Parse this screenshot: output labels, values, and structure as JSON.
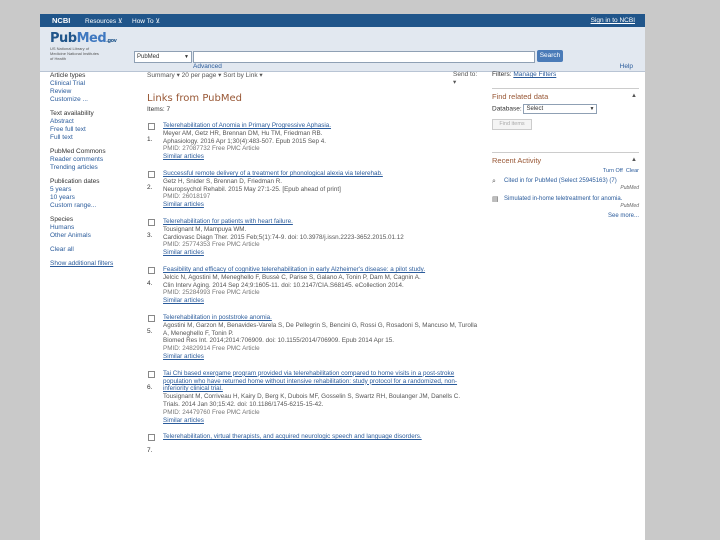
{
  "topbar": {
    "ncbi": "NCBI",
    "resources": "Resources ⊻",
    "howto": "How To ⊻",
    "signin": "Sign in to NCBI"
  },
  "logo": {
    "pub": "Pub",
    "med": "Med",
    "gov": ".gov",
    "nlm": "US National Library of Medicine National Institutes of Health"
  },
  "search": {
    "db": "PubMed",
    "button": "Search",
    "advanced": "Advanced",
    "help": "Help"
  },
  "sidebar": {
    "groups": [
      [
        "Article types",
        "Clinical Trial",
        "Review",
        "Customize ..."
      ],
      [
        "Text availability",
        "Abstract",
        "Free full text",
        "Full text"
      ],
      [
        "PubMed Commons",
        "Reader comments",
        "Trending articles"
      ],
      [
        "Publication dates",
        "5 years",
        "10 years",
        "Custom range..."
      ],
      [
        "Species",
        "Humans",
        "Other Animals"
      ]
    ],
    "clear": "Clear all",
    "show_more": "Show additional filters"
  },
  "toolbar": {
    "summary": "Summary ▾   20 per page ▾   Sort by Link ▾",
    "send": "Send to: ▾"
  },
  "heading": "Links from PubMed",
  "items_label": "Items: 7",
  "results": [
    {
      "num": "1.",
      "title": "Telerehabilitation of Anomia in Primary Progressive Aphasia.",
      "authors": "Meyer AM, Getz HR, Brennan DM, Hu TM, Friedman RB.",
      "journal": "Aphasiology. 2016 Apr 1;30(4):483-507. Epub 2015 Sep 4.",
      "pmid": "PMID: 27087732     Free PMC Article",
      "similar": "Similar articles"
    },
    {
      "num": "2.",
      "title": "Successful remote delivery of a treatment for phonological alexia via telerehab.",
      "authors": "Getz H, Snider S, Brennan D, Friedman R.",
      "journal": "Neuropsychol Rehabil. 2015 May 27:1-25. [Epub ahead of print]",
      "pmid": "PMID: 26018197",
      "similar": "Similar articles"
    },
    {
      "num": "3.",
      "title": "Telerehabilitation for patients with heart failure.",
      "authors": "Tousignant M, Mampuya WM.",
      "journal": "Cardiovasc Diagn Ther. 2015 Feb;5(1):74-9. doi: 10.3978/j.issn.2223-3652.2015.01.12",
      "pmid": "PMID: 25774353     Free PMC Article",
      "similar": "Similar articles"
    },
    {
      "num": "4.",
      "title": "Feasibility and efficacy of cognitive telerehabilitation in early Alzheimer's disease: a pilot study.",
      "authors": "Jelcic N, Agostini M, Meneghello F, Bussè C, Parise S, Galano A, Tonin P, Dam M, Cagnin A.",
      "journal": "Clin Interv Aging. 2014 Sep 24;9:1605-11. doi: 10.2147/CIA.S68145. eCollection 2014.",
      "pmid": "PMID: 25284993     Free PMC Article",
      "similar": "Similar articles"
    },
    {
      "num": "5.",
      "title": "Telerehabilitation in poststroke anomia.",
      "authors": "Agostini M, Garzon M, Benavides-Varela S, De Pellegrin S, Bencini G, Rossi G, Rosadoni S, Mancuso M, Turolla A, Meneghello F, Tonin P.",
      "journal": "Biomed Res Int. 2014;2014:706909. doi: 10.1155/2014/706909. Epub 2014 Apr 15.",
      "pmid": "PMID: 24829914     Free PMC Article",
      "similar": "Similar articles"
    },
    {
      "num": "6.",
      "title": "Tai Chi based exergame program provided via telerehabilitation compared to home visits in a post-stroke population who have returned home without intensive rehabilitation: study protocol for a randomized, non-inferiority clinical trial.",
      "authors": "Tousignant M, Corriveau H, Kairy D, Berg K, Dubois MF, Gosselin S, Swartz RH, Boulanger JM, Danells C.",
      "journal": "Trials. 2014 Jan 30;15:42. doi: 10.1186/1745-6215-15-42.",
      "pmid": "PMID: 24479760     Free PMC Article",
      "similar": "Similar articles"
    },
    {
      "num": "7.",
      "title": "Telerehabilitation, virtual therapists, and acquired neurologic speech and language disorders.",
      "authors": "",
      "journal": "",
      "pmid": "",
      "similar": ""
    }
  ],
  "right": {
    "filters": "Filters:",
    "manage": "Manage Filters",
    "find_related": "Find related data",
    "database_label": "Database:",
    "database_value": "Select",
    "find_button": "Find items",
    "recent_activity": "Recent Activity",
    "turn_off": "Turn Off",
    "clear": "Clear",
    "activities": [
      {
        "icon": "search-icon",
        "text": "Cited in for PubMed (Select 25945163) (7)",
        "source": "PubMed"
      },
      {
        "icon": "document-icon",
        "text": "Simulated in-home teletreatment for anomia.",
        "source": "PubMed"
      }
    ],
    "see_more": "See more..."
  }
}
